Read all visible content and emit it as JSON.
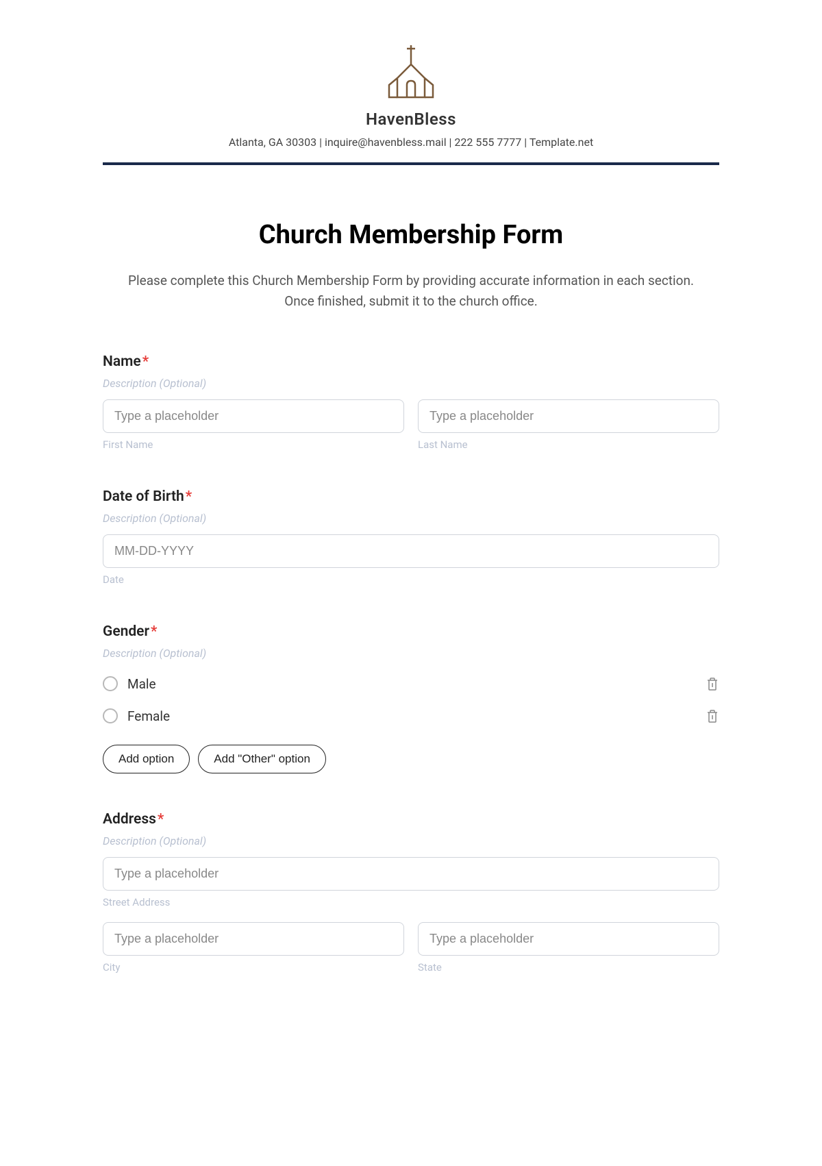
{
  "header": {
    "brand_name": "HavenBless",
    "contact_line": "Atlanta, GA 30303 | inquire@havenbless.mail | 222 555 7777 | Template.net"
  },
  "form": {
    "title": "Church Membership Form",
    "description": "Please complete this Church Membership Form by providing accurate information in each section. Once finished, submit it to the church office."
  },
  "fields": {
    "name": {
      "label": "Name",
      "required": "*",
      "desc": "Description (Optional)",
      "first_placeholder": "Type a placeholder",
      "first_sublabel": "First Name",
      "last_placeholder": "Type a placeholder",
      "last_sublabel": "Last Name"
    },
    "dob": {
      "label": "Date of Birth",
      "required": "*",
      "desc": "Description (Optional)",
      "placeholder": "MM-DD-YYYY",
      "sublabel": "Date"
    },
    "gender": {
      "label": "Gender",
      "required": "*",
      "desc": "Description (Optional)",
      "options": [
        "Male",
        "Female"
      ],
      "add_option": "Add option",
      "add_other": "Add \"Other\" option"
    },
    "address": {
      "label": "Address",
      "required": "*",
      "desc": "Description (Optional)",
      "street_placeholder": "Type a placeholder",
      "street_sublabel": "Street Address",
      "city_placeholder": "Type a placeholder",
      "city_sublabel": "City",
      "state_placeholder": "Type a placeholder",
      "state_sublabel": "State"
    }
  }
}
